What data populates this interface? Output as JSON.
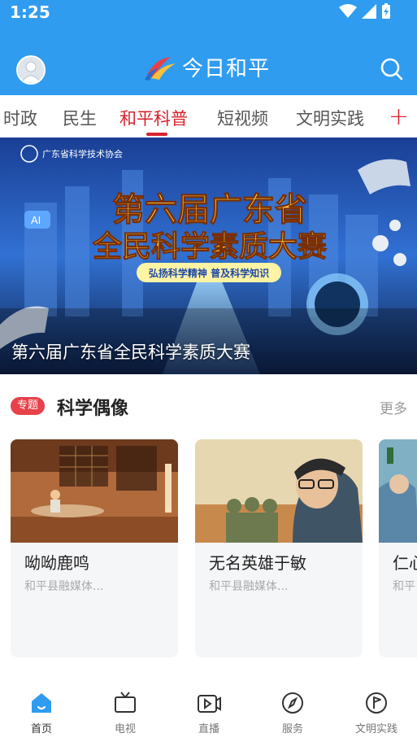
{
  "status": {
    "time": "1:25"
  },
  "header": {
    "title": "今日和平"
  },
  "tabs": [
    {
      "label": "时政"
    },
    {
      "label": "民生"
    },
    {
      "label": "和平科普",
      "active": true
    },
    {
      "label": "短视频"
    },
    {
      "label": "文明实践"
    }
  ],
  "banner": {
    "caption": "第六届广东省全民科学素质大赛",
    "headline_line1": "第六届广东省",
    "headline_line2": "全民科学素质大赛",
    "slogan": "弘扬科学精神  普及科学知识",
    "org": "广东省科学技术协会"
  },
  "section": {
    "badge": "专题",
    "title": "科学偶像",
    "more": "更多",
    "cards": [
      {
        "title": "呦呦鹿鸣",
        "source": "和平县融媒体..."
      },
      {
        "title": "无名英雄于敏",
        "source": "和平县融媒体..."
      },
      {
        "title": "仁心",
        "source": "和平"
      }
    ]
  },
  "nav": [
    {
      "label": "首页",
      "icon": "home-icon",
      "active": true
    },
    {
      "label": "电视",
      "icon": "tv-icon"
    },
    {
      "label": "直播",
      "icon": "live-icon"
    },
    {
      "label": "服务",
      "icon": "compass-icon"
    },
    {
      "label": "文明实践",
      "icon": "flag-icon"
    }
  ],
  "colors": {
    "header": "#2f9cf0",
    "accent": "#d9232d",
    "nav_active": "#2f9cf0",
    "badge": "#e8414a"
  }
}
